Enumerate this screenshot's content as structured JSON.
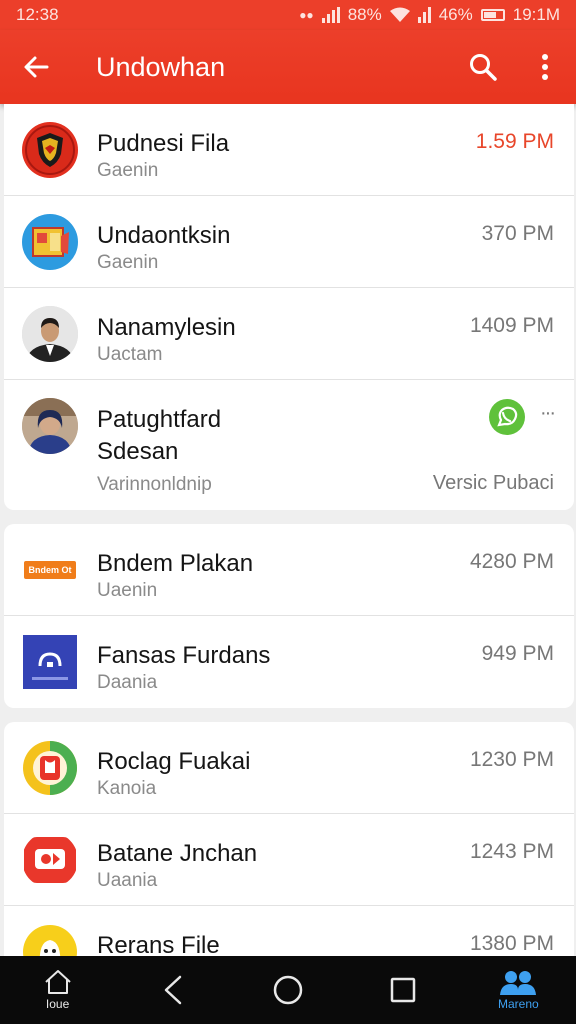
{
  "status": {
    "time": "12:38",
    "mute": "🔇",
    "battery_text": "88%",
    "wifi": "46%",
    "clock": "19:1M"
  },
  "appbar": {
    "title": "Undowhan"
  },
  "colors": {
    "accent": "#e8462a",
    "appbar": "#ec3f2a",
    "whatsapp": "#5fc13b"
  },
  "items": [
    {
      "name": "Pudnesi Fila",
      "sub": "Gaenin",
      "time": "1.59 PM"
    },
    {
      "name": "Undaontksin",
      "sub": "Gaenin",
      "time": "370 PM"
    },
    {
      "name": "Nanamylesin",
      "sub": "Uactam",
      "time": "1409 PM"
    },
    {
      "name": "Patughtfard",
      "name2": "Sdesan",
      "sub": "Varinnonldnip",
      "time_text": "Versic Pubaci",
      "more": "···"
    },
    {
      "name": "Bndem Plakan",
      "sub": "Uaenin",
      "time": "4280 PM",
      "logo_text": "Bndem Ot"
    },
    {
      "name": "Fansas Furdans",
      "sub": "Daania",
      "time": "949 PM"
    },
    {
      "name": "Roclag Fuakai",
      "sub": "Kanoia",
      "time": "1230 PM"
    },
    {
      "name": "Batane Jnchan",
      "sub": "Uaania",
      "time": "1243 PM"
    },
    {
      "name": "Rerans File",
      "sub": "",
      "time": "1380 PM"
    }
  ],
  "nav": {
    "home_label": "Ioue",
    "active_label": "Mareno"
  }
}
